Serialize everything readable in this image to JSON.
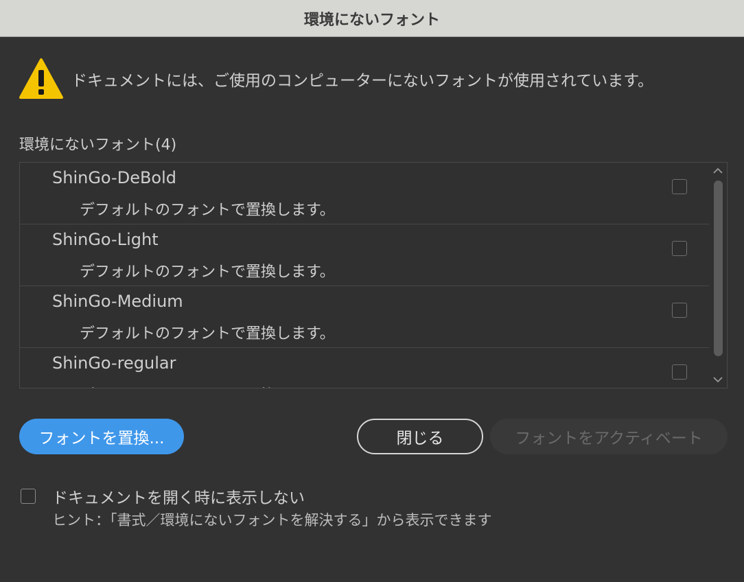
{
  "window": {
    "title": "環境にないフォント"
  },
  "warning": {
    "icon": "warning-triangle-icon",
    "icon_color": "#f5c400",
    "message": "ドキュメントには、ご使用のコンピューターにないフォントが使用されています。"
  },
  "missing_fonts": {
    "label": "環境にないフォント(4)",
    "items": [
      {
        "name": "ShinGo-DeBold",
        "action": "デフォルトのフォントで置換します。",
        "checked": false
      },
      {
        "name": "ShinGo-Light",
        "action": "デフォルトのフォントで置換します。",
        "checked": false
      },
      {
        "name": "ShinGo-Medium",
        "action": "デフォルトのフォントで置換します。",
        "checked": false
      },
      {
        "name": "ShinGo-regular",
        "action": "デフォルトのフォントで置換します。",
        "checked": false
      }
    ]
  },
  "buttons": {
    "replace": "フォントを置換...",
    "close": "閉じる",
    "activate": "フォントをアクティベート"
  },
  "footer": {
    "dont_show_label": "ドキュメントを開く時に表示しない",
    "dont_show_checked": false,
    "hint": "ヒント：「書式／環境にないフォントを解決する」から表示できます"
  },
  "colors": {
    "accent": "#3f97ea",
    "background": "#323232",
    "titlebar": "#d6d6d3"
  }
}
